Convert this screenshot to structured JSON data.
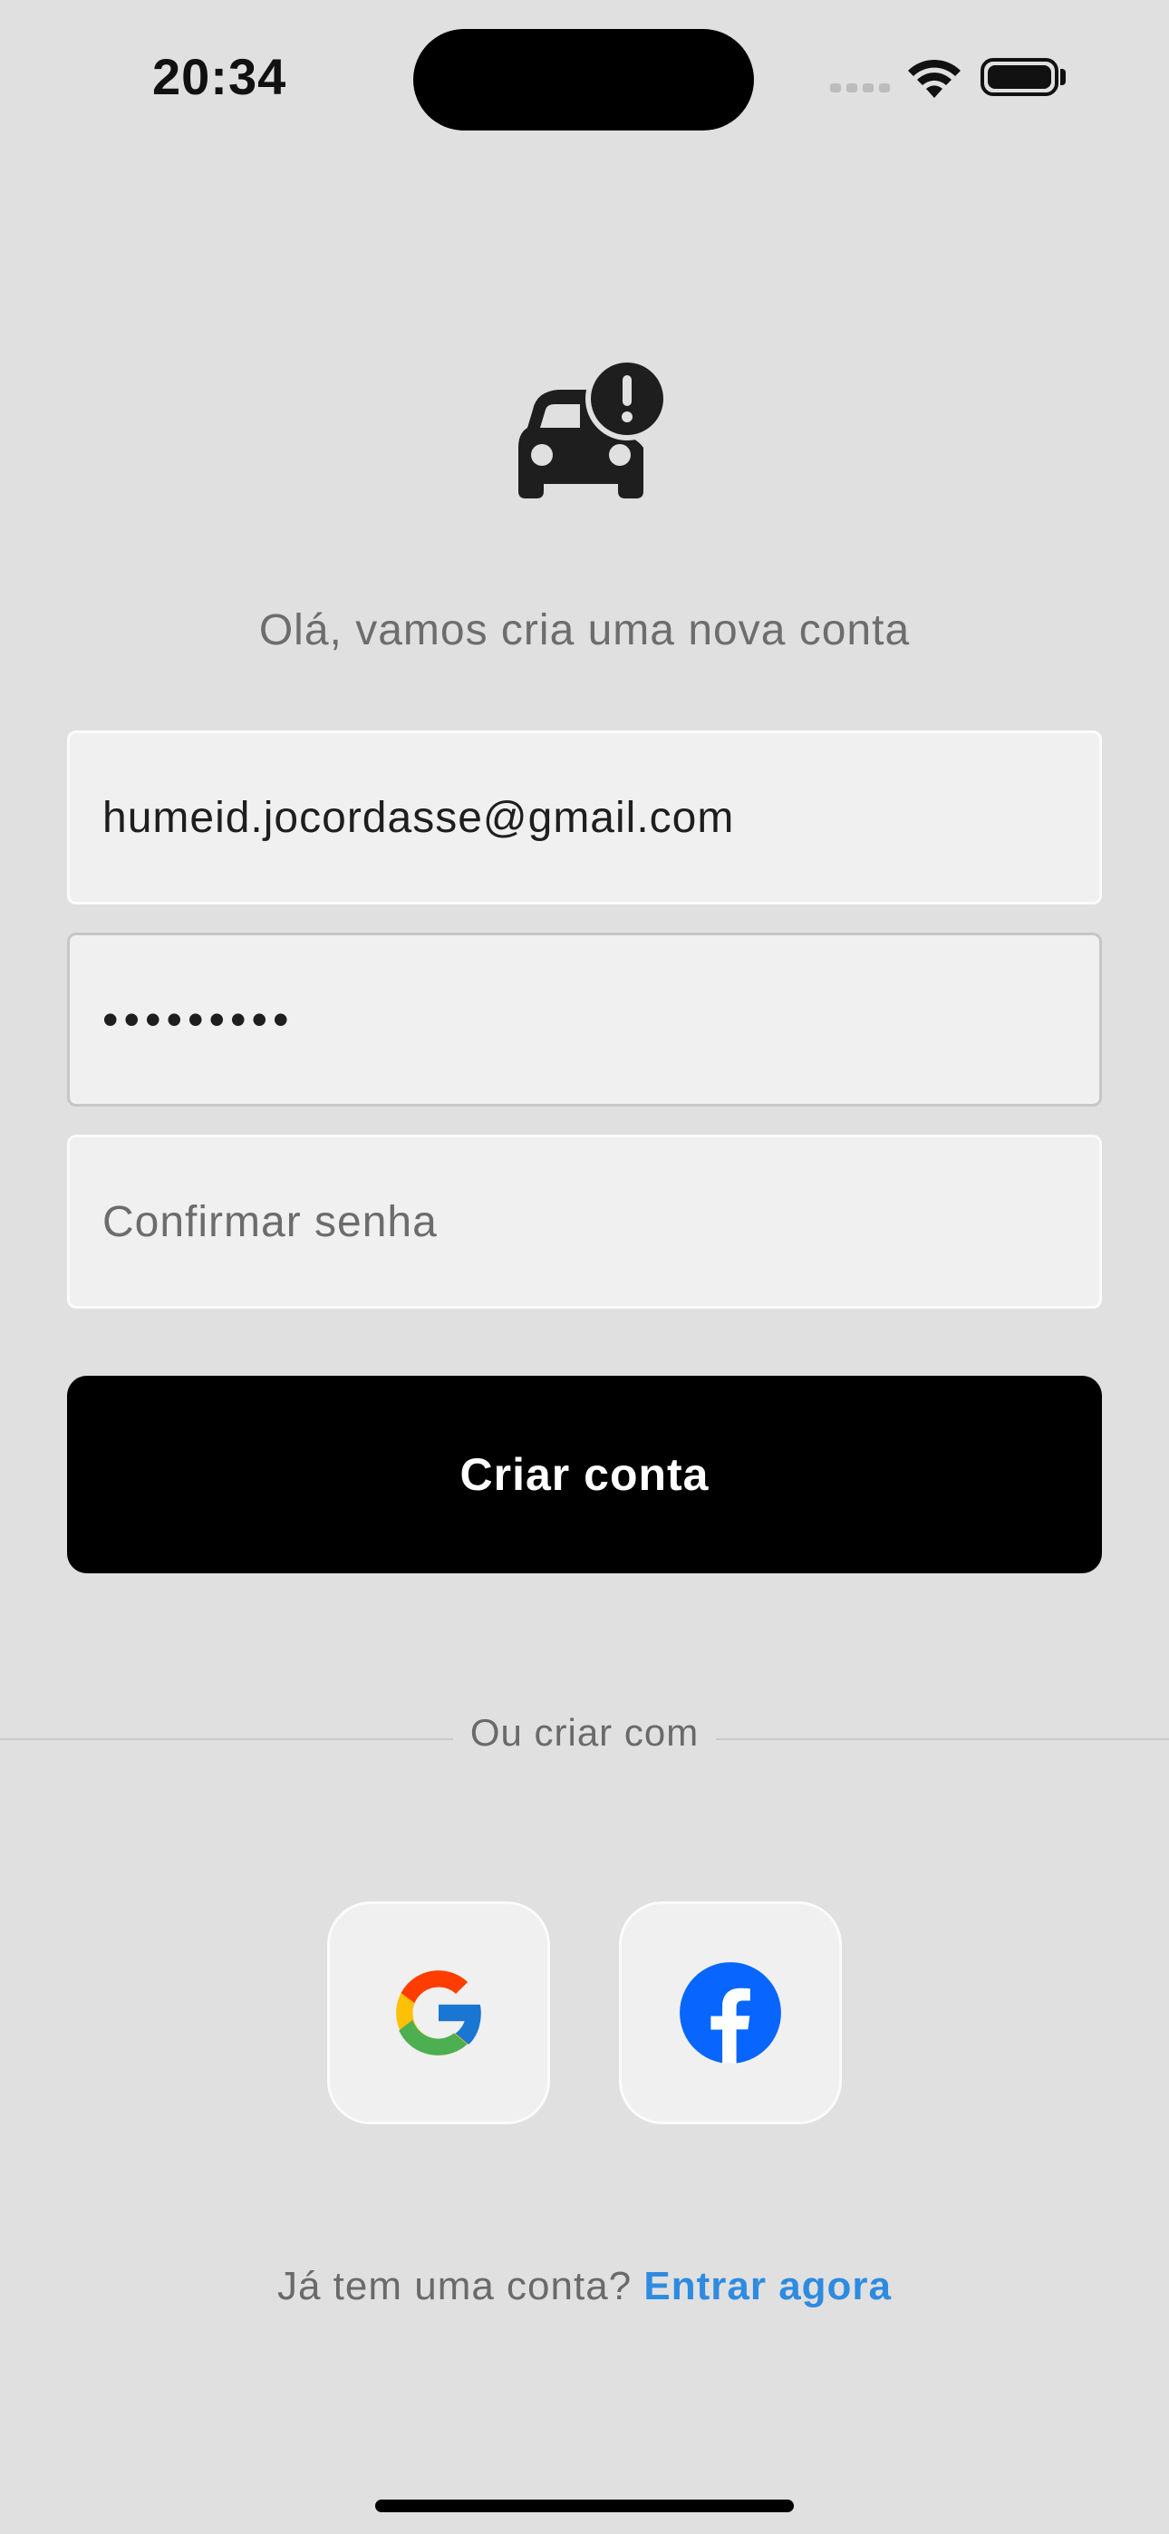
{
  "status_bar": {
    "time": "20:34"
  },
  "header": {
    "subtitle": "Olá, vamos cria uma nova conta"
  },
  "form": {
    "email_value": "humeid.jocordasse@gmail.com",
    "password_value": "•••••••••",
    "confirm_placeholder": "Confirmar senha",
    "submit_label": "Criar conta"
  },
  "social": {
    "divider_label": "Ou criar com",
    "providers": [
      "google-icon",
      "facebook-icon"
    ]
  },
  "footer": {
    "prompt": "Já tem uma conta? ",
    "link_label": "Entrar agora",
    "link_color": "#2d8be0"
  },
  "colors": {
    "background": "#e0e0e0",
    "primary_button": "#000000",
    "facebook_blue": "#0866ff"
  }
}
